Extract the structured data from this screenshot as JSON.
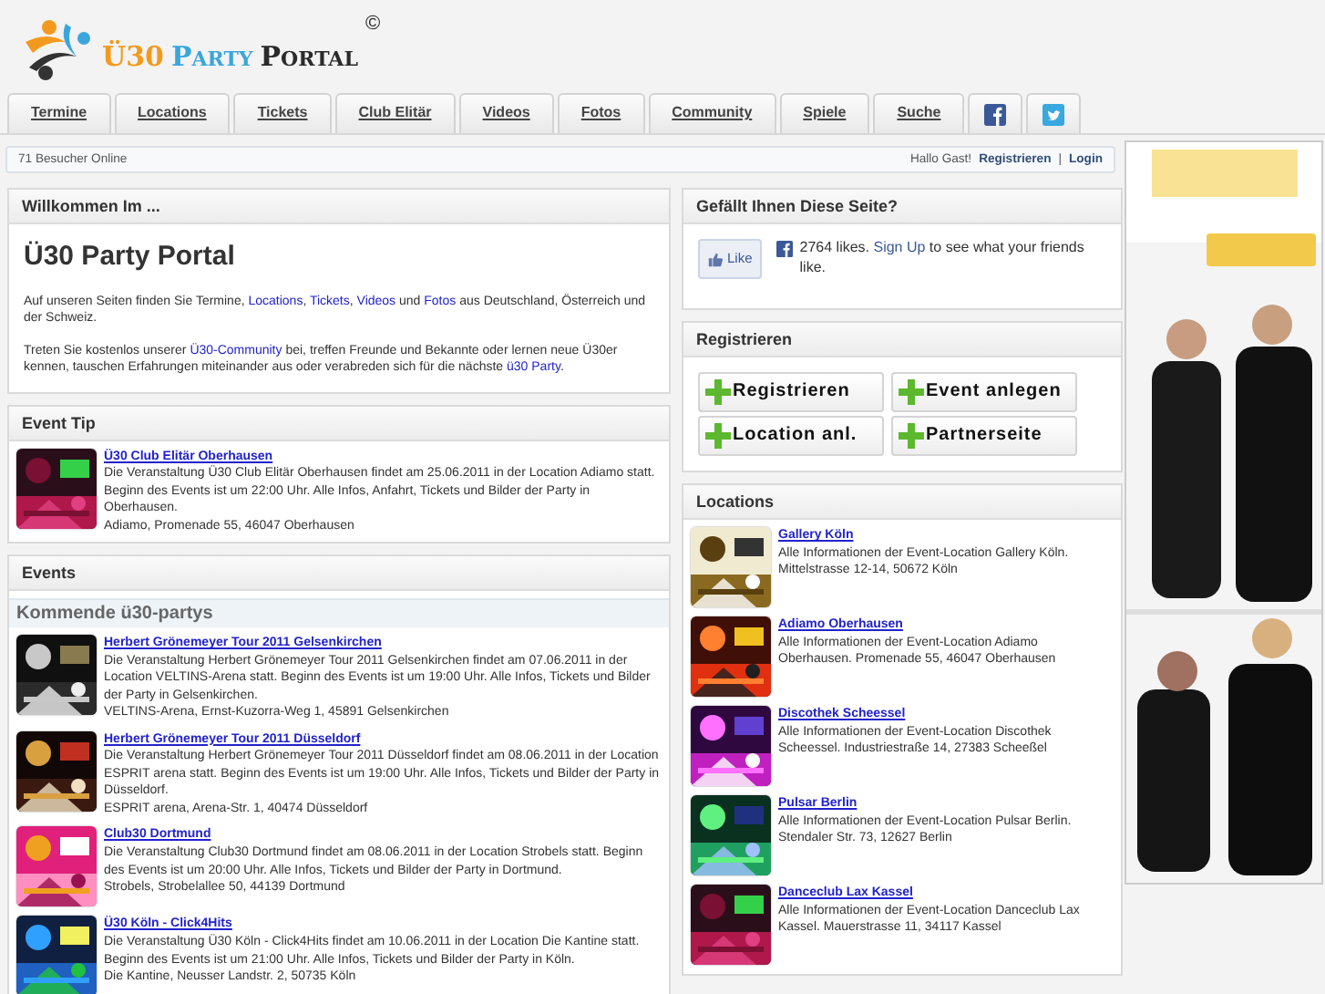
{
  "logo": {
    "parts": [
      {
        "text": "Ü30",
        "color": "#f39a1e"
      },
      {
        "text": "Party",
        "color": "#3aa6dd"
      },
      {
        "text": "Portal",
        "color": "#2b2b2b"
      }
    ],
    "mark": "©"
  },
  "nav": [
    {
      "kind": "text",
      "label": "Termine"
    },
    {
      "kind": "text",
      "label": "Locations"
    },
    {
      "kind": "text",
      "label": "Tickets"
    },
    {
      "kind": "text",
      "label": "Club Elitär"
    },
    {
      "kind": "text",
      "label": "Videos"
    },
    {
      "kind": "text",
      "label": "Fotos"
    },
    {
      "kind": "text",
      "label": "Community"
    },
    {
      "kind": "text",
      "label": "Spiele"
    },
    {
      "kind": "text",
      "label": "Suche"
    },
    {
      "kind": "facebook"
    },
    {
      "kind": "twitter"
    }
  ],
  "status_bar": {
    "visitors": "71 Besucher Online",
    "greeting": "Hallo Gast!",
    "links": [
      "Registrieren",
      "Login"
    ],
    "separator": "|"
  },
  "welcome": {
    "heading": "Willkommen Im ...",
    "title": "Ü30 Party Portal",
    "paragraphs": [
      [
        {
          "text": "Auf unseren Seiten finden Sie Termine, "
        },
        {
          "text": "Locations",
          "link": true
        },
        {
          "text": ", "
        },
        {
          "text": "Tickets",
          "link": true
        },
        {
          "text": ", "
        },
        {
          "text": "Videos",
          "link": true
        },
        {
          "text": " und "
        },
        {
          "text": "Fotos",
          "link": true
        },
        {
          "text": " aus Deutschland, Österreich und der Schweiz."
        }
      ],
      [
        {
          "text": "Treten Sie kostenlos unserer "
        },
        {
          "text": "Ü30-Community",
          "link": true
        },
        {
          "text": " bei, treffen Freunde und Bekannte oder lernen neue Ü30er kennen, tauschen Erfahrungen miteinander aus oder verabreden sich für die nächste "
        },
        {
          "text": "ü30 Party",
          "link": true
        },
        {
          "text": "."
        }
      ]
    ]
  },
  "event_tip": {
    "heading": "Event Tip",
    "items": [
      {
        "title": "Ü30 Club Elitär Oberhausen",
        "description": "Die Veranstaltung Ü30 Club Elitär Oberhausen findet am 25.06.2011 in der Location Adiamo statt. Beginn des Events ist um 22:00 Uhr. Alle Infos, Anfahrt, Tickets und Bilder der Party in Oberhausen.",
        "address": "Adiamo, Promenade 55, 46047 Oberhausen",
        "kind": "picture"
      }
    ]
  },
  "events": {
    "heading": "Events",
    "subheading": "Kommende ü30-partys",
    "items": [
      {
        "title": "Herbert Grönemeyer Tour 2011 Gelsenkirchen",
        "description": "Die Veranstaltung Herbert Grönemeyer Tour 2011 Gelsenkirchen findet am 07.06.2011 in der Location VELTINS-Arena statt. Beginn des Events ist um 19:00 Uhr. Alle Infos, Tickets und Bilder der Party in Gelsenkirchen.",
        "address": "VELTINS-Arena, Ernst-Kuzorra-Weg 1, 45891 Gelsenkirchen",
        "kind": "picture"
      },
      {
        "title": "Herbert Grönemeyer Tour 2011 Düsseldorf",
        "description": "Die Veranstaltung Herbert Grönemeyer Tour 2011 Düsseldorf findet am 08.06.2011 in der Location ESPRIT arena statt. Beginn des Events ist um 19:00 Uhr. Alle Infos, Tickets und Bilder der Party in Düsseldorf.",
        "address": "ESPRIT arena, Arena-Str. 1, 40474 Düsseldorf",
        "kind": "picture"
      },
      {
        "title": "Club30 Dortmund",
        "description": "Die Veranstaltung Club30 Dortmund findet am 08.06.2011 in der Location Strobels statt. Beginn des Events ist um 20:00 Uhr. Alle Infos, Tickets und Bilder der Party in Dortmund.",
        "address": "Strobels, Strobelallee 50, 44139 Dortmund",
        "kind": "picture"
      },
      {
        "title": "Ü30 Köln - Click4Hits",
        "description": "Die Veranstaltung Ü30 Köln - Click4Hits findet am 10.06.2011 in der Location Die Kantine statt. Beginn des Events ist um 21:00 Uhr. Alle Infos, Tickets und Bilder der Party in Köln.",
        "address": "Die Kantine, Neusser Landstr. 2, 50735 Köln",
        "kind": "picture"
      }
    ]
  },
  "like_box": {
    "heading": "Gefällt Ihnen Diese Seite?",
    "button": "Like",
    "count": "2764 likes.",
    "link": "Sign Up",
    "rest": "to see what your friends like."
  },
  "register": {
    "heading": "Registrieren",
    "buttons": [
      "Registrieren",
      "Event anlegen",
      "Location anl.",
      "Partnerseite"
    ]
  },
  "locations": {
    "heading": "Locations",
    "items": [
      {
        "title": "Gallery Köln",
        "description": "Alle Informationen der Event-Location Gallery Köln. Mittelstrasse 12-14, 50672 Köln",
        "kind": "picture"
      },
      {
        "title": "Adiamo Oberhausen",
        "description": "Alle Informationen der Event-Location Adiamo Oberhausen. Promenade 55, 46047 Oberhausen",
        "kind": "picture"
      },
      {
        "title": "Discothek Scheessel",
        "description": "Alle Informationen der Event-Location Discothek Scheessel. Industriestraße 14, 27383 Scheeßel",
        "kind": "picture"
      },
      {
        "title": "Pulsar Berlin",
        "description": "Alle Informationen der Event-Location Pulsar Berlin. Stendaler Str. 73, 12627 Berlin",
        "kind": "picture"
      },
      {
        "title": "Danceclub Lax Kassel",
        "description": "Alle Informationen der Event-Location Danceclub Lax Kassel. Mauerstrasse 11, 34117 Kassel",
        "kind": "picture"
      }
    ]
  }
}
